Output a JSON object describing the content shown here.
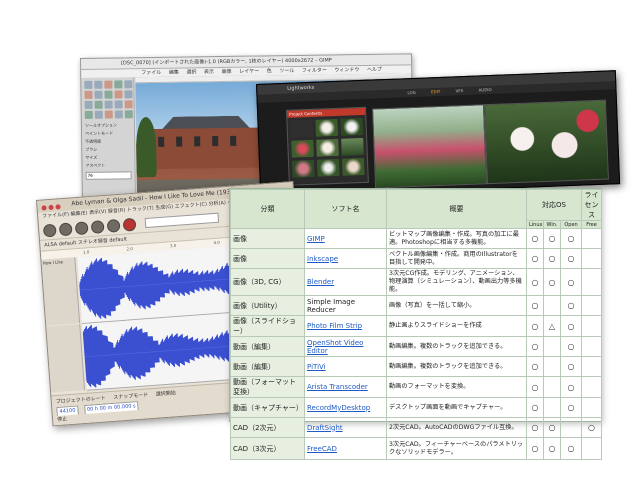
{
  "gimp": {
    "title": "[DSC_0070] (インポートされた画像)-1.0 (RGBカラー, 1枚のレイヤー) 4000x2672 – GIMP",
    "menu": [
      "ファイル",
      "編集",
      "選択",
      "表示",
      "画像",
      "レイヤー",
      "色",
      "ツール",
      "フィルター",
      "ウィンドウ",
      "ヘルプ"
    ],
    "tool_options": [
      "ツールオプション",
      "ペイントモード",
      "不透明度",
      "ブラシ",
      "サイズ",
      "アスペクト"
    ],
    "field_value": "76"
  },
  "lightworks": {
    "title": "Lightworks",
    "tabs": [
      "LOG",
      "EDIT",
      "VFX",
      "AUDIO"
    ],
    "active_tab": "EDIT",
    "bin_title": "Project Contents"
  },
  "audacity": {
    "title": "Abe Lyman & Olga Sadil - How I Like To Love Me (1937)",
    "menu": "ファイル(F)  編集(E)  表示(V)  録音(R)  トラック(T)  生成(G)  エフェクト(C)  分析(A)  ヘルプ(H)",
    "device": "ALSA   default   ステレオ録音   default",
    "ruler": "1.0 2.0 3.0 4.0",
    "track_label": "How I Like",
    "bottom_rate_label": "プロジェクトのレート",
    "bottom_rate": "44100",
    "bottom_snap": "スナップモード",
    "bottom_sel": "選択開始",
    "bottom_sel_value": "00 h 00 m 00.000 s",
    "status": "停止"
  },
  "table": {
    "headers": {
      "category": "分類",
      "software": "ソフト名",
      "summary": "概要",
      "os": "対応OS",
      "license": "ライセンス",
      "linux": "Linux",
      "win": "Win.",
      "open": "Open",
      "free": "Free"
    },
    "rows": [
      {
        "category": "画像",
        "software": "GIMP",
        "link": true,
        "desc": "ビットマップ画像編集・作成。写真の加工に最適。Photoshopに相当する多機能。",
        "linux": "○",
        "win": "○",
        "open": "○",
        "free": ""
      },
      {
        "category": "画像",
        "software": "Inkscape",
        "link": true,
        "desc": "ベクトル画像編集・作成。商用のIllustratorを目指して開発中。",
        "linux": "○",
        "win": "○",
        "open": "○",
        "free": ""
      },
      {
        "category": "画像（3D, CG）",
        "software": "Blender",
        "link": true,
        "desc": "3次元CG作成。モデリング、アニメーション、物理演算（シミュレーション）、動画出力等多機能。",
        "linux": "○",
        "win": "○",
        "open": "○",
        "free": ""
      },
      {
        "category": "画像（Utility）",
        "software": "Simple Image Reducer",
        "link": false,
        "desc": "画像（写真）を一括して縮小。",
        "linux": "○",
        "win": "",
        "open": "○",
        "free": ""
      },
      {
        "category": "画像（スライドショー）",
        "software": "Photo Film Strip",
        "link": true,
        "desc": "静止画よりスライドショーを作成",
        "linux": "○",
        "win": "△",
        "open": "○",
        "free": ""
      },
      {
        "category": "動画（編集）",
        "software": "OpenShot Video Editor",
        "link": true,
        "desc": "動画編集。複数のトラックを追加できる。",
        "linux": "○",
        "win": "",
        "open": "○",
        "free": ""
      },
      {
        "category": "動画（編集）",
        "software": "PiTiVi",
        "link": true,
        "desc": "動画編集。複数のトラックを追加できる。",
        "linux": "○",
        "win": "",
        "open": "○",
        "free": ""
      },
      {
        "category": "動画（フォーマット変換）",
        "software": "Arista Transcoder",
        "link": true,
        "desc": "動画のフォーマットを変換。",
        "linux": "○",
        "win": "",
        "open": "○",
        "free": ""
      },
      {
        "category": "動画（キャプチャー）",
        "software": "RecordMyDesktop",
        "link": true,
        "desc": "デスクトップ画面を動画でキャプチャー。",
        "linux": "○",
        "win": "",
        "open": "○",
        "free": ""
      },
      {
        "category": "CAD（2次元）",
        "software": "DraftSight",
        "link": true,
        "desc": "2次元CAD。AutoCADのDWGファイル互換。",
        "linux": "○",
        "win": "○",
        "open": "",
        "free": "○"
      },
      {
        "category": "CAD（3次元）",
        "software": "FreeCAD",
        "link": true,
        "desc": "3次元CAD。フィーチャーベースのパラメトリックなソリッドモデラー。",
        "linux": "○",
        "win": "○",
        "open": "○",
        "free": ""
      }
    ]
  }
}
